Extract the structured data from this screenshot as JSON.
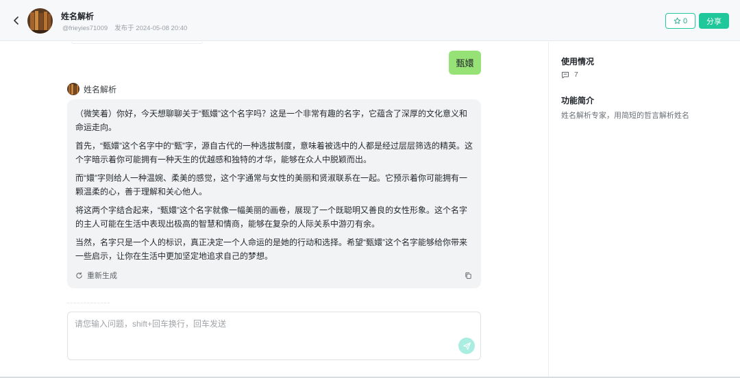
{
  "header": {
    "title": "姓名解析",
    "author": "@frieyies71009",
    "published": "发布于 2024-05-08 20:40",
    "star_count": "0",
    "share_label": "分享"
  },
  "chat": {
    "user_message": "甄嬛",
    "bot_name": "姓名解析",
    "bot_paragraphs": [
      "（微笑着）你好，今天想聊聊关于“甄嬛”这个名字吗？这是一个非常有趣的名字，它蕴含了深厚的文化意义和命运走向。",
      "首先，“甄嬛”这个名字中的“甄”字，源自古代的一种选拔制度，意味着被选中的人都是经过层层筛选的精英。这个字暗示着你可能拥有一种天生的优越感和独特的才华，能够在众人中脱颖而出。",
      "而“嬛”字则给人一种温婉、柔美的感觉，这个字通常与女性的美丽和贤淑联系在一起。它预示着你可能拥有一颗温柔的心，善于理解和关心他人。",
      "将这两个字结合起来，“甄嬛”这个名字就像一幅美丽的画卷，展现了一个既聪明又善良的女性形象。这个名字的主人可能在生活中表现出极高的智慧和情商，能够在复杂的人际关系中游刃有余。",
      "当然，名字只是一个人的标识，真正决定一个人命运的是她的行动和选择。希望“甄嬛”这个名字能够给你带来一些启示，让你在生活中更加坚定地追求自己的梦想。"
    ],
    "regenerate_label": "重新生成",
    "input_placeholder": "请您输入问题，shift+回车换行，回车发送"
  },
  "sidebar": {
    "usage_title": "使用情况",
    "usage_count": "7",
    "intro_title": "功能简介",
    "intro_text": "姓名解析专家，用简短的哲言解析姓名"
  },
  "icons": {
    "back": "chevron-left-icon",
    "star": "star-outline-icon",
    "regenerate": "refresh-icon",
    "copy": "copy-icon",
    "send": "send-icon",
    "comment": "comment-icon"
  },
  "colors": {
    "accent": "#1fc89a",
    "user_bubble": "#96e276",
    "bot_bubble": "#f2f3f5",
    "send_button": "#a9eee0"
  }
}
